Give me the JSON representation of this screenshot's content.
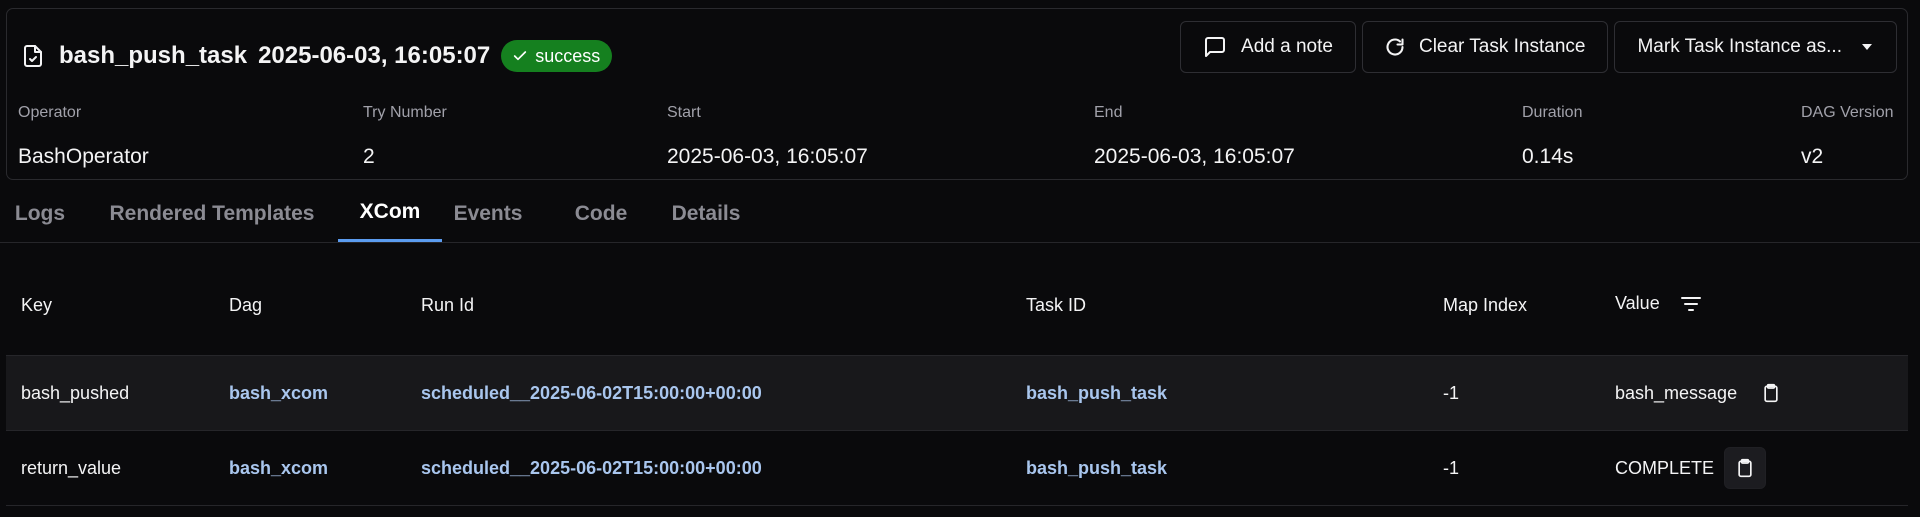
{
  "header": {
    "task_name": "bash_push_task",
    "task_date": "2025-06-03, 16:05:07",
    "status": "success",
    "status_color": "#15801f"
  },
  "actions": {
    "add_note": "Add a note",
    "clear": "Clear Task Instance",
    "mark": "Mark Task Instance as..."
  },
  "meta": {
    "operator_label": "Operator",
    "operator": "BashOperator",
    "try_label": "Try Number",
    "try": "2",
    "start_label": "Start",
    "start": "2025-06-03, 16:05:07",
    "end_label": "End",
    "end": "2025-06-03, 16:05:07",
    "duration_label": "Duration",
    "duration": "0.14s",
    "version_label": "DAG Version",
    "version": "v2"
  },
  "tabs": [
    "Logs",
    "Rendered Templates",
    "XCom",
    "Events",
    "Code",
    "Details"
  ],
  "active_tab": "XCom",
  "table": {
    "columns": [
      "Key",
      "Dag",
      "Run Id",
      "Task ID",
      "Map Index",
      "Value"
    ],
    "rows": [
      {
        "key": "bash_pushed",
        "dag": "bash_xcom",
        "run_id": "scheduled__2025-06-02T15:00:00+00:00",
        "task_id": "bash_push_task",
        "map_index": "-1",
        "value": "bash_message"
      },
      {
        "key": "return_value",
        "dag": "bash_xcom",
        "run_id": "scheduled__2025-06-02T15:00:00+00:00",
        "task_id": "bash_push_task",
        "map_index": "-1",
        "value": "COMPLETE"
      }
    ]
  },
  "icons": {
    "title": "file-check-icon",
    "badge": "check-icon",
    "note": "message-square-icon",
    "clear": "rotate-cw-icon",
    "mark": "caret-down-icon",
    "filter": "filter-icon",
    "copy": "clipboard-icon"
  },
  "colors": {
    "accent": "#5b9cf0",
    "link": "#a9c6ee",
    "success": "#15801f"
  }
}
